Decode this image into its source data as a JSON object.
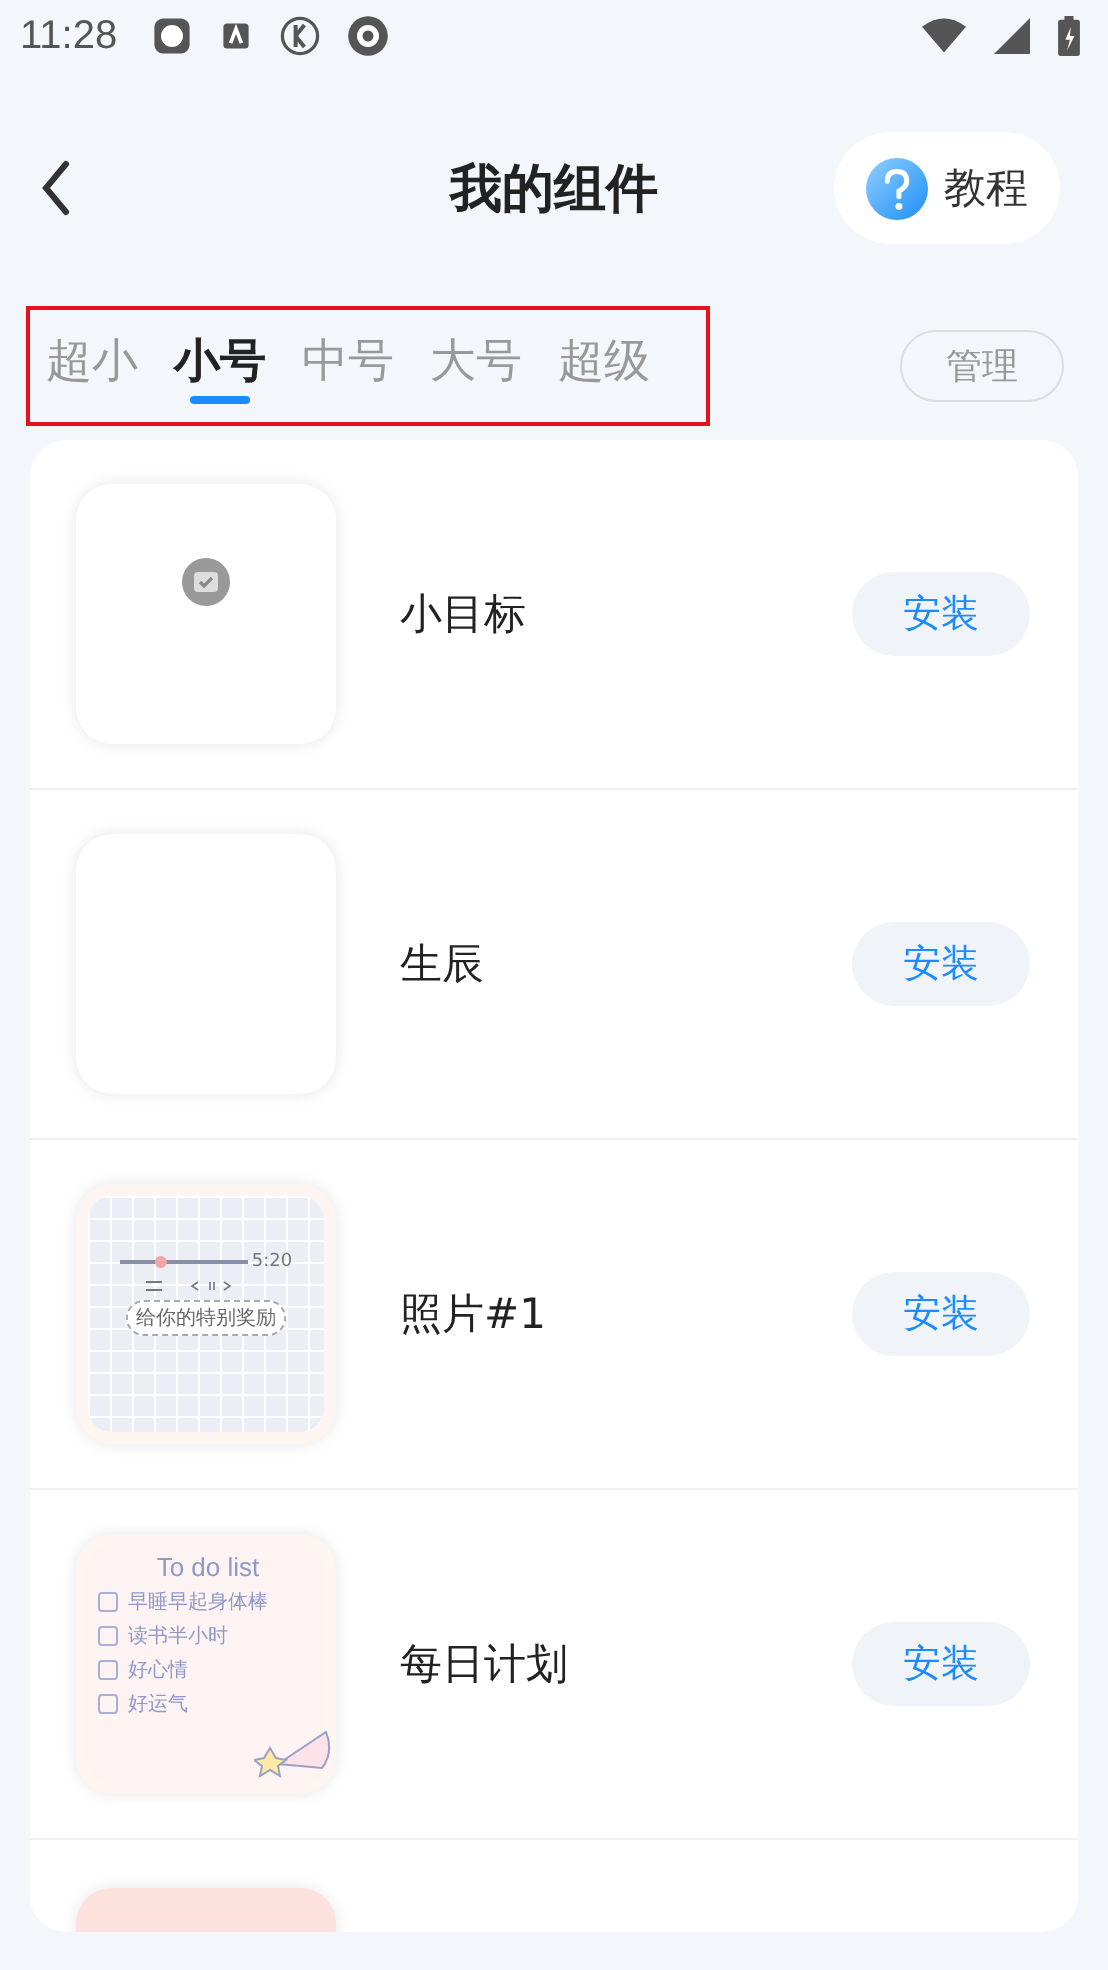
{
  "status_bar": {
    "time": "11:28"
  },
  "header": {
    "title": "我的组件",
    "help_label": "教程"
  },
  "tabs": [
    {
      "label": "超小",
      "selected": false
    },
    {
      "label": "小号",
      "selected": true
    },
    {
      "label": "中号",
      "selected": false
    },
    {
      "label": "大号",
      "selected": false
    },
    {
      "label": "超级",
      "selected": false
    }
  ],
  "manage_button": "管理",
  "widgets": [
    {
      "name": "小目标",
      "button": "安装",
      "preview": {
        "kind": "icon"
      }
    },
    {
      "name": "生辰",
      "button": "安装",
      "preview": {
        "kind": "blank"
      }
    },
    {
      "name": "照片#1",
      "button": "安装",
      "preview": {
        "kind": "music",
        "level": 0.3,
        "time": "5:20",
        "caption": "给你的特别奖励"
      }
    },
    {
      "name": "每日计划",
      "button": "安装",
      "preview": {
        "kind": "todo",
        "title": "To do list",
        "items": [
          {
            "text": "早睡早起身体棒",
            "checked": false
          },
          {
            "text": "读书半小时",
            "checked": false
          },
          {
            "text": "好心情",
            "checked": false
          },
          {
            "text": "好运气",
            "checked": false
          }
        ]
      }
    },
    {
      "preview": {
        "kind": "pink"
      }
    }
  ]
}
